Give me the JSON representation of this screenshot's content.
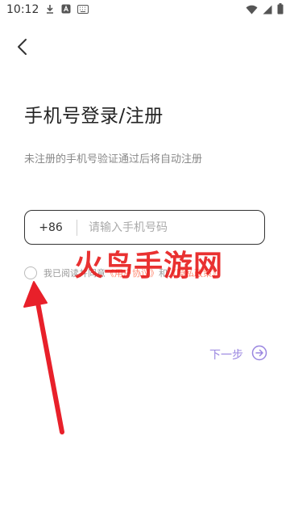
{
  "status_bar": {
    "time": "10:12",
    "icons": [
      "download-icon",
      "a-badge-icon",
      "keyboard-icon",
      "wifi-icon",
      "signal-icon",
      "battery-icon"
    ]
  },
  "header": {
    "back_icon": "chevron-left-icon"
  },
  "login": {
    "title": "手机号登录/注册",
    "subtitle": "未注册的手机号验证通过后将自动注册",
    "country_code": "+86",
    "phone_placeholder": "请输入手机号码",
    "agreement_prefix": "我已阅读并同意",
    "user_agreement": "《用户协议》",
    "agreement_and": "和",
    "privacy_policy": "《隐私政策》",
    "next_label": "下一步",
    "next_icon": "arrow-right-circle-icon"
  },
  "watermark": {
    "text": "火鸟手游网"
  },
  "colors": {
    "accent": "#9a86e0",
    "link": "#ff8a72",
    "watermark": "#e61414",
    "arrow": "#e8202a"
  }
}
